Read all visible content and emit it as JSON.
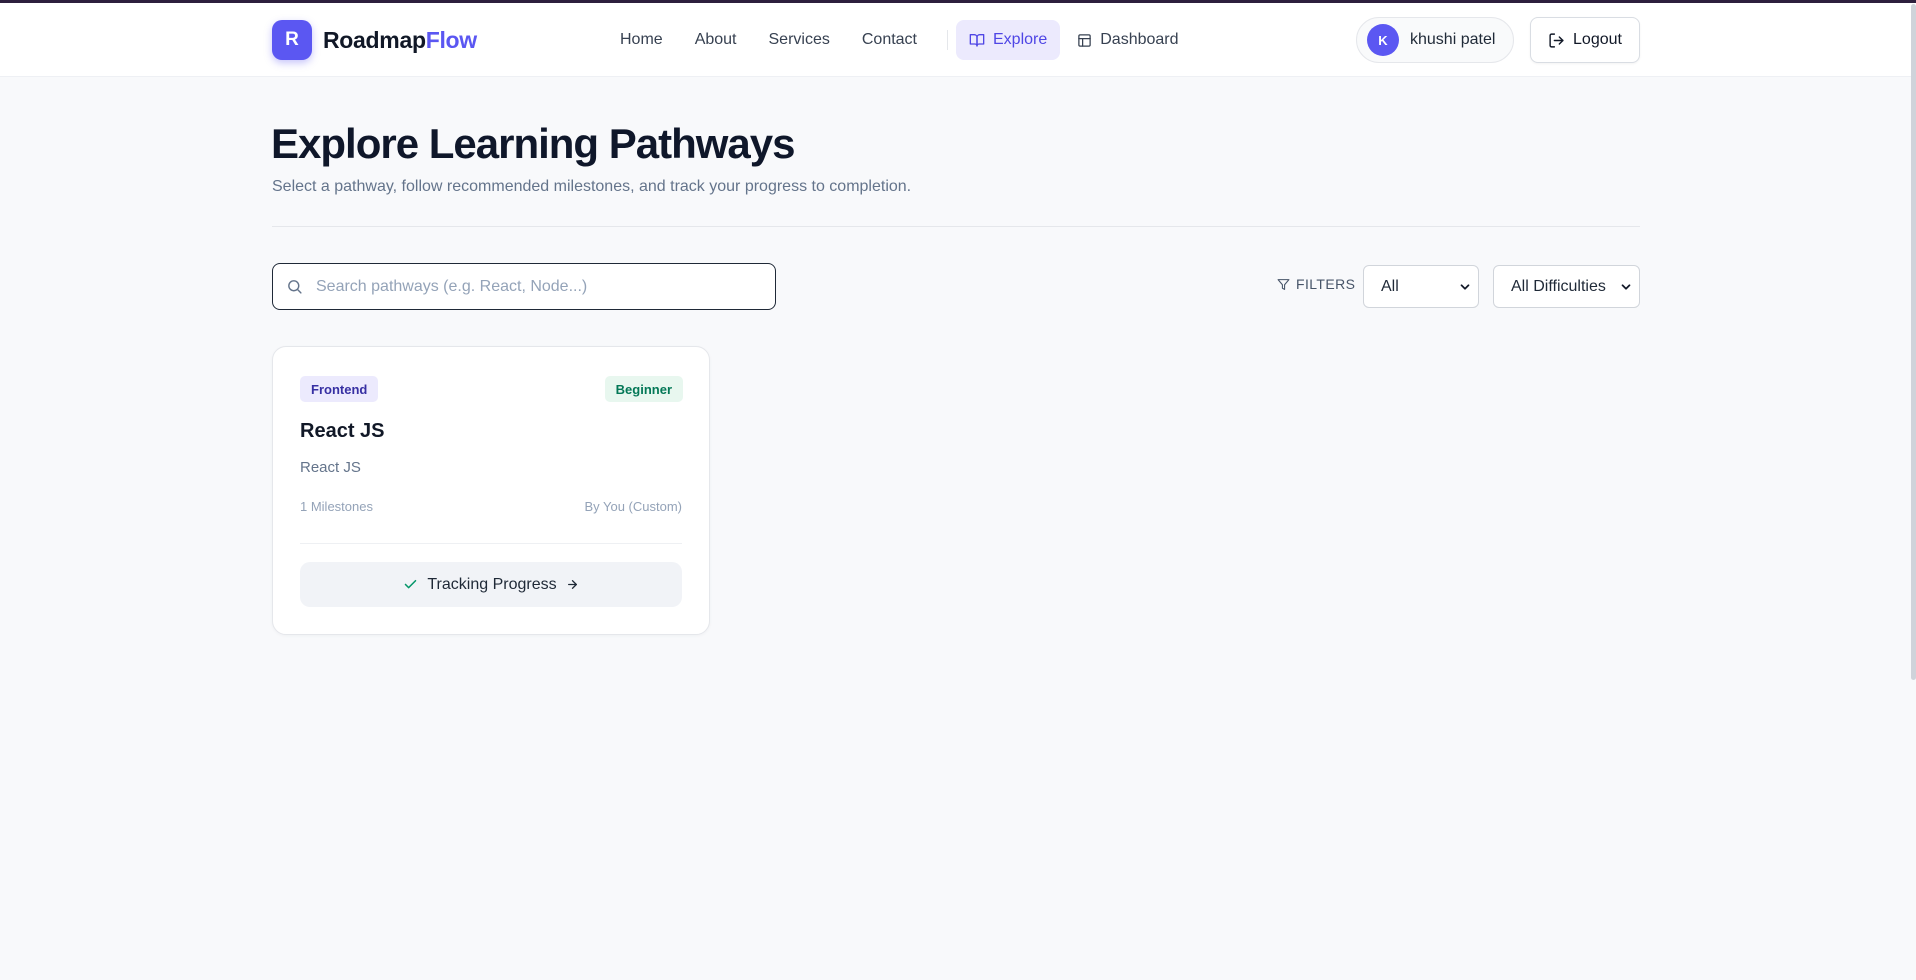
{
  "brand": {
    "badge": "R",
    "name_main": "Roadmap",
    "name_accent": "Flow",
    "accent_color": "#5b57f2"
  },
  "nav": {
    "links": [
      {
        "label": "Home"
      },
      {
        "label": "About"
      },
      {
        "label": "Services"
      },
      {
        "label": "Contact"
      }
    ],
    "explore_label": "Explore",
    "dashboard_label": "Dashboard"
  },
  "user": {
    "initial": "K",
    "name": "khushi patel",
    "logout_label": "Logout"
  },
  "page": {
    "title": "Explore Learning Pathways",
    "subtitle": "Select a pathway, follow recommended milestones, and track your progress to completion."
  },
  "search": {
    "placeholder": "Search pathways (e.g. React, Node...)",
    "value": ""
  },
  "filters": {
    "label": "FILTERS",
    "category_selected": "All",
    "difficulty_selected": "All Difficulties"
  },
  "pathways": [
    {
      "category": "Frontend",
      "difficulty": "Beginner",
      "title": "React JS",
      "description": "React JS",
      "milestones": "1 Milestones",
      "author": "By You (Custom)",
      "action_label": "Tracking Progress"
    }
  ]
}
